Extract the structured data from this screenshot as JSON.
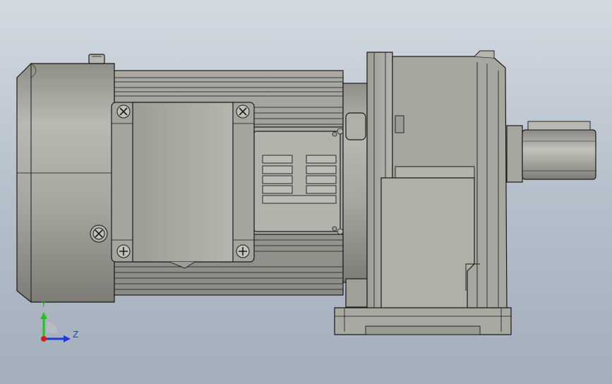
{
  "viewport": {
    "background_top": "#d2d9e1",
    "background_bottom": "#a3aebb"
  },
  "model": {
    "name": "",
    "body_color": "#a8a8a0",
    "edge_color": "#1a1a1a"
  },
  "triad": {
    "y_label": "Y",
    "z_label": "Z",
    "y_color": "#22c222",
    "z_color": "#1c3cd8",
    "x_color": "#d81c1c"
  }
}
